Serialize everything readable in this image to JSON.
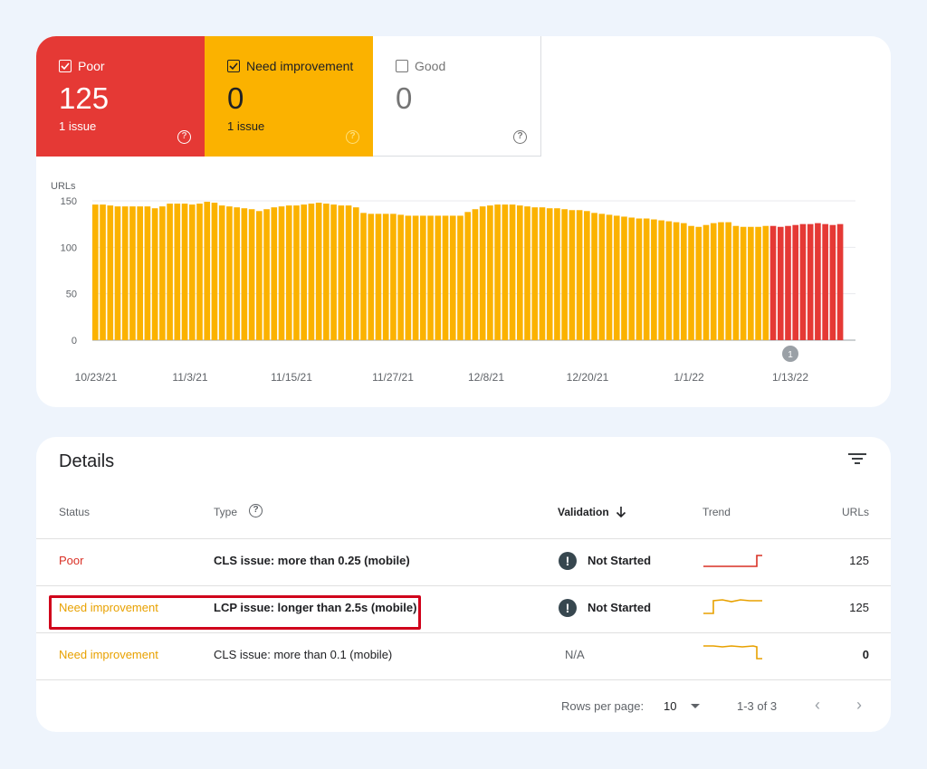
{
  "tiles": {
    "poor": {
      "label": "Poor",
      "count": "125",
      "issues": "1 issue",
      "checked": true
    },
    "ni": {
      "label": "Need improvement",
      "count": "0",
      "issues": "1 issue",
      "checked": true
    },
    "good": {
      "label": "Good",
      "count": "0",
      "checked": false
    }
  },
  "chart_data": {
    "type": "bar",
    "ylabel": "URLs",
    "ylim": [
      0,
      150
    ],
    "yticks": [
      0,
      50,
      100,
      150
    ],
    "x_tick_labels": [
      "10/23/21",
      "11/3/21",
      "11/15/21",
      "11/27/21",
      "12/8/21",
      "12/20/21",
      "1/1/22",
      "1/13/22"
    ],
    "annotation": "1",
    "series": [
      {
        "name": "Need improvement",
        "color": "#fbb200",
        "values": [
          146,
          146,
          145,
          144,
          144,
          144,
          144,
          144,
          142,
          144,
          147,
          147,
          147,
          146,
          147,
          149,
          148,
          145,
          144,
          143,
          142,
          141,
          139,
          141,
          143,
          144,
          145,
          145,
          146,
          147,
          148,
          147,
          146,
          145,
          145,
          143,
          137,
          136,
          136,
          136,
          136,
          135,
          134,
          134,
          134,
          134,
          134,
          134,
          134,
          134,
          138,
          141,
          144,
          145,
          146,
          146,
          146,
          145,
          144,
          143,
          143,
          142,
          142,
          141,
          140,
          140,
          139,
          137,
          136,
          135,
          134,
          133,
          132,
          131,
          131,
          130,
          129,
          128,
          127,
          126,
          123,
          122,
          124,
          126,
          127,
          127,
          123,
          122,
          122,
          122,
          123
        ]
      },
      {
        "name": "Poor",
        "color": "#e53935",
        "values": [
          123,
          122,
          123,
          124,
          125,
          125,
          126,
          125,
          124,
          125
        ]
      }
    ]
  },
  "details": {
    "title": "Details",
    "headers": {
      "status": "Status",
      "type": "Type",
      "validation": "Validation",
      "trend": "Trend",
      "urls": "URLs"
    },
    "rows": [
      {
        "status": "Poor",
        "type": "CLS issue: more than 0.25 (mobile)",
        "validation": "Not Started",
        "urls": "125"
      },
      {
        "status": "Need improvement",
        "type": "LCP issue: longer than 2.5s (mobile)",
        "validation": "Not Started",
        "urls": "125"
      },
      {
        "status": "Need improvement",
        "type": "CLS issue: more than 0.1 (mobile)",
        "validation": "N/A",
        "urls": "0"
      }
    ],
    "footer": {
      "rows_per_page_label": "Rows per page:",
      "rows_per_page_value": "10",
      "range": "1-3 of 3"
    }
  },
  "colors": {
    "poor": "#e53935",
    "need_improvement": "#fbb200",
    "highlight": "#d0021b"
  }
}
